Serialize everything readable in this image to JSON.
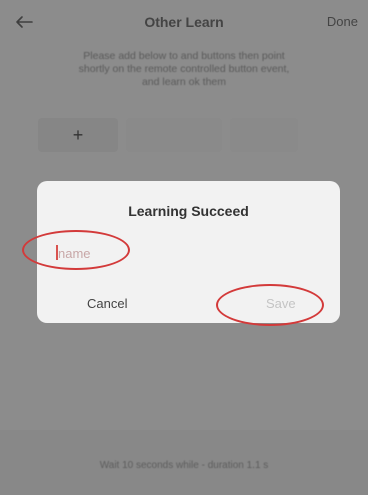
{
  "header": {
    "back_icon": "arrow-left-icon",
    "title": "Other Learn",
    "done_label": "Done"
  },
  "instructions": {
    "text": "Please add below to and buttons then point shortly on the remote controlled button event, and learn ok them"
  },
  "key_row": {
    "add_icon": "plus-icon",
    "add_label": "+"
  },
  "dialog": {
    "title": "Learning Succeed",
    "name_placeholder": "name",
    "name_value": "",
    "cancel_label": "Cancel",
    "save_label": "Save"
  },
  "footer": {
    "text": "Wait 10 seconds while - duration 1.1 s"
  },
  "colors": {
    "overlay": "#8c8c8c",
    "dialog_bg": "#f2f2f2",
    "annotation": "#d33a3a",
    "save_disabled": "#c4c4c4"
  }
}
